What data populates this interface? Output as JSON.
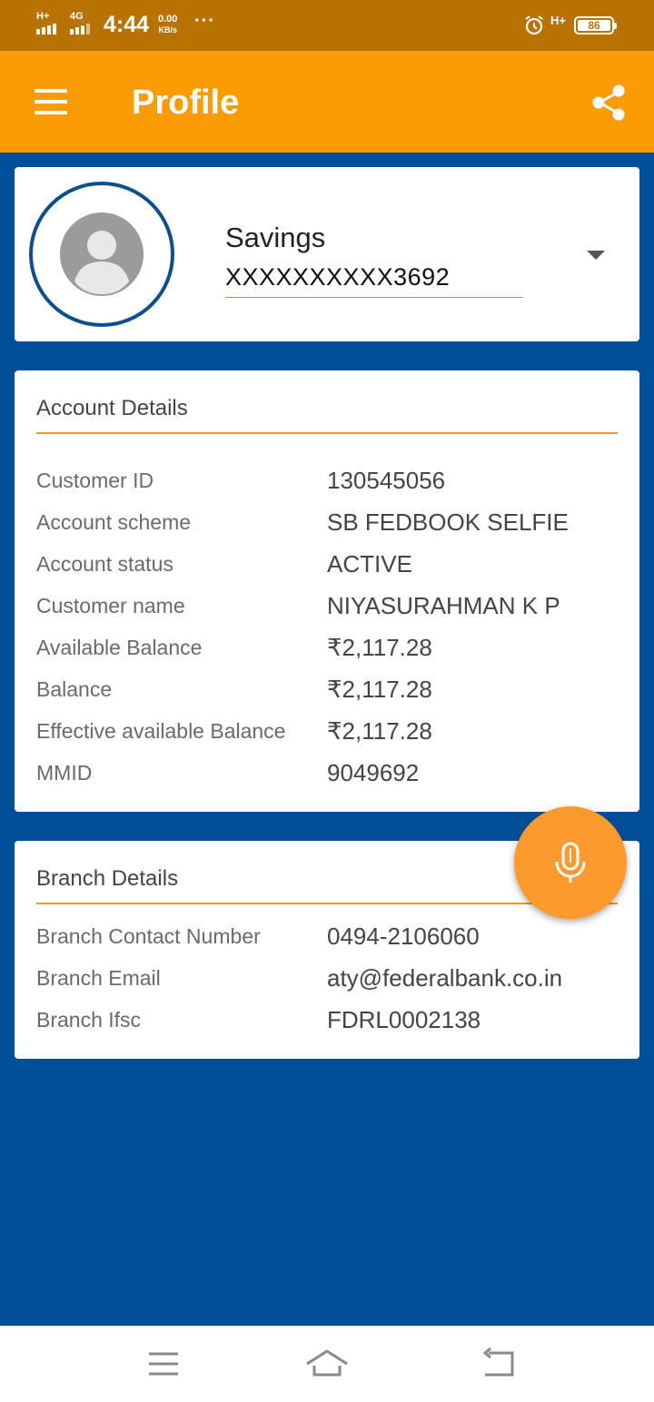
{
  "status_bar": {
    "network_left_1": "H+",
    "network_left_2": "4G",
    "time": "4:44",
    "speed_value": "0.00",
    "speed_unit": "KB/s",
    "dots": "···",
    "network_right": "H+",
    "battery": "86"
  },
  "app_bar": {
    "title": "Profile",
    "menu_icon": "hamburger-menu-icon",
    "share_icon": "share-icon",
    "background": "#fd9b05"
  },
  "profile": {
    "account_type": "Savings",
    "account_number": "XXXXXXXXXX3692"
  },
  "account_details": {
    "title": "Account Details",
    "rows": [
      {
        "label": "Customer ID",
        "value": "130545056"
      },
      {
        "label": "Account scheme",
        "value": "SB FEDBOOK SELFIE"
      },
      {
        "label": "Account status",
        "value": "ACTIVE"
      },
      {
        "label": "Customer name",
        "value": "NIYASURAHMAN K P"
      },
      {
        "label": "Available Balance",
        "value": "₹2,117.28"
      },
      {
        "label": "Balance",
        "value": "₹2,117.28"
      },
      {
        "label": "Effective available Balance",
        "value": "₹2,117.28"
      },
      {
        "label": "MMID",
        "value": "9049692"
      }
    ]
  },
  "branch_details": {
    "title": "Branch Details",
    "rows": [
      {
        "label": "Branch Contact Number",
        "value": "0494-2106060"
      },
      {
        "label": "Branch Email",
        "value": "aty@federalbank.co.in"
      },
      {
        "label": "Branch Ifsc",
        "value": "FDRL0002138"
      }
    ]
  },
  "fab": {
    "icon": "microphone-icon",
    "color": "#fd9a2e"
  },
  "colors": {
    "page_background": "#004f98",
    "accent": "#f39a1d",
    "status_bar": "#b77200"
  }
}
